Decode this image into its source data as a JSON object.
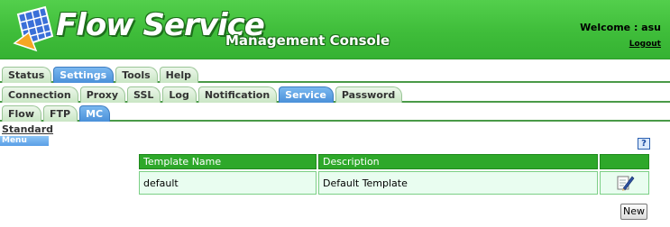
{
  "header": {
    "brand": "Flow Service",
    "subtitle": "Management Console",
    "welcome": "Welcome : asu",
    "logout": "Logout"
  },
  "tabs_primary": [
    {
      "label": "Status",
      "active": false
    },
    {
      "label": "Settings",
      "active": true
    },
    {
      "label": "Tools",
      "active": false
    },
    {
      "label": "Help",
      "active": false
    }
  ],
  "tabs_settings": [
    {
      "label": "Connection",
      "active": false
    },
    {
      "label": "Proxy",
      "active": false
    },
    {
      "label": "SSL",
      "active": false
    },
    {
      "label": "Log",
      "active": false
    },
    {
      "label": "Notification",
      "active": false
    },
    {
      "label": "Service",
      "active": true
    },
    {
      "label": "Password",
      "active": false
    }
  ],
  "tabs_service": [
    {
      "label": "Flow",
      "active": false
    },
    {
      "label": "FTP",
      "active": false
    },
    {
      "label": "MC",
      "active": true
    }
  ],
  "menu": {
    "standard": "Standard",
    "label": "Menu"
  },
  "help": "?",
  "table": {
    "headers": [
      "Template Name",
      "Description",
      ""
    ],
    "rows": [
      {
        "name": "default",
        "description": "Default Template"
      }
    ]
  },
  "new_button": "New",
  "colors": {
    "banner": "#3fbd3a",
    "active_tab": "#4a90d9",
    "table_header": "#2ea82a",
    "table_cell": "#e9fdf0"
  },
  "icons": {
    "logo": "logo-icon",
    "help": "help-icon",
    "edit": "edit-icon"
  }
}
